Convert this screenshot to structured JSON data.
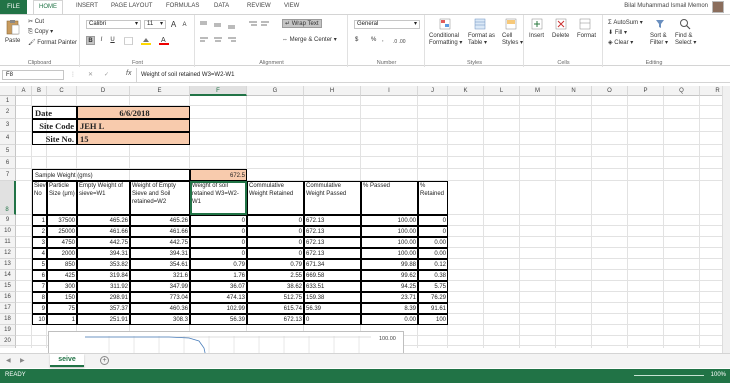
{
  "ribbon_tabs": {
    "file": "FILE",
    "home": "HOME",
    "insert": "INSERT",
    "page_layout": "PAGE LAYOUT",
    "formulas": "FORMULAS",
    "data": "DATA",
    "review": "REVIEW",
    "view": "VIEW"
  },
  "user_name": "Bilal Muhammad Ismail Memon",
  "clipboard": {
    "paste": "Paste",
    "cut": "Cut",
    "copy": "Copy",
    "format_painter": "Format Painter",
    "label": "Clipboard"
  },
  "font": {
    "name": "Calibri",
    "size": "11",
    "label": "Font",
    "bold": "B",
    "italic": "I",
    "underline": "U",
    "grow": "A",
    "shrink": "A"
  },
  "alignment": {
    "wrap_text": "Wrap Text",
    "merge_center": "Merge & Center",
    "label": "Alignment"
  },
  "number": {
    "format": "General",
    "currency": "$",
    "percent": "%",
    "comma": ",",
    "label": "Number"
  },
  "styles": {
    "conditional": "Conditional",
    "formatting": "Formatting",
    "format_as": "Format as",
    "table": "Table",
    "cell": "Cell",
    "styles_btn": "Styles",
    "label": "Styles"
  },
  "cells": {
    "insert": "Insert",
    "delete": "Delete",
    "format": "Format",
    "label": "Cells"
  },
  "editing": {
    "autosum": "AutoSum",
    "fill": "Fill",
    "clear": "Clear",
    "sort_filter": "Sort &",
    "filter": "Filter",
    "find": "Find &",
    "select": "Select",
    "label": "Editing"
  },
  "formula_bar": {
    "name_box": "F8",
    "cancel": "✕",
    "enter": "✓",
    "fx": "fx",
    "content": "Weight of soil retained W3=W2-W1"
  },
  "columns": [
    "A",
    "B",
    "C",
    "D",
    "E",
    "F",
    "G",
    "H",
    "I",
    "J",
    "K",
    "L",
    "M",
    "N",
    "O",
    "P",
    "Q",
    "R"
  ],
  "rows": [
    "1",
    "2",
    "3",
    "4",
    "5",
    "6",
    "7",
    "8",
    "9",
    "10",
    "11",
    "12",
    "13",
    "14",
    "15",
    "16",
    "17",
    "18",
    "19",
    "20",
    "21"
  ],
  "info": {
    "date_label": "Date",
    "date_value": "6/6/2018",
    "site_code_label": "Site Code",
    "site_code_value": "JEH L",
    "site_no_label": "Site No.",
    "site_no_value": "15"
  },
  "sample": {
    "label": "Sample Weight (gms)",
    "value": "672.5"
  },
  "headers": [
    "Sieve No",
    "Particle Size (μm)",
    "Empty Weight of sieve=W1",
    "Weight of Empty Sieve and Soil retained=W2",
    "Weight of soil retained W3=W2-W1",
    "Commulative Weight Retained",
    "Commulative Weight Passed",
    "% Passed",
    "% Retained"
  ],
  "table_rows": [
    [
      "1",
      "37500",
      "465.26",
      "465.26",
      "0",
      "0",
      "672.13",
      "100.00",
      "0"
    ],
    [
      "2",
      "25000",
      "461.66",
      "461.66",
      "0",
      "0",
      "672.13",
      "100.00",
      "0"
    ],
    [
      "3",
      "4750",
      "442.75",
      "442.75",
      "0",
      "0",
      "672.13",
      "100.00",
      "0.00"
    ],
    [
      "4",
      "2000",
      "394.31",
      "394.31",
      "0",
      "0",
      "672.13",
      "100.00",
      "0.00"
    ],
    [
      "5",
      "850",
      "353.82",
      "354.61",
      "0.79",
      "0.79",
      "671.34",
      "99.88",
      "0.12"
    ],
    [
      "6",
      "425",
      "319.84",
      "321.6",
      "1.76",
      "2.55",
      "669.58",
      "99.62",
      "0.38"
    ],
    [
      "7",
      "300",
      "311.92",
      "347.99",
      "36.07",
      "38.62",
      "633.51",
      "94.25",
      "5.75"
    ],
    [
      "8",
      "150",
      "298.91",
      "773.04",
      "474.13",
      "512.75",
      "159.38",
      "23.71",
      "76.29"
    ],
    [
      "9",
      "75",
      "357.37",
      "460.36",
      "102.99",
      "615.74",
      "56.39",
      "8.39",
      "91.61"
    ],
    [
      "10",
      "1",
      "251.91",
      "308.3",
      "56.39",
      "672.13",
      "0",
      "0.00",
      "100"
    ]
  ],
  "chart_label": "100.00",
  "sheet_tab": "seive",
  "add_sheet": "+",
  "status": {
    "ready": "READY",
    "zoom": "100%"
  }
}
